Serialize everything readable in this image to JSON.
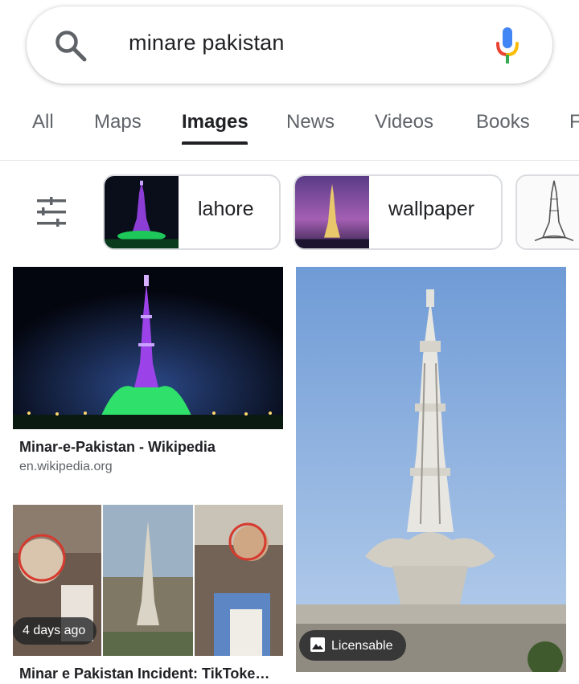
{
  "search": {
    "query": "minare pakistan"
  },
  "tabs": [
    {
      "label": "All"
    },
    {
      "label": "Maps"
    },
    {
      "label": "Images"
    },
    {
      "label": "News"
    },
    {
      "label": "Videos"
    },
    {
      "label": "Books"
    },
    {
      "label": "F"
    }
  ],
  "chips": [
    {
      "label": "lahore"
    },
    {
      "label": "wallpaper"
    },
    {
      "label": ""
    }
  ],
  "results": [
    {
      "title": "Minar-e-Pakistan - Wikipedia",
      "source": "en.wikipedia.org"
    },
    {
      "badge": "Licensable"
    },
    {
      "title": "Minar e Pakistan Incident: TikToke…",
      "badge": "4 days ago"
    }
  ],
  "colors": {
    "google_blue": "#4285f4",
    "google_red": "#ea4335",
    "google_yellow": "#fbbc05",
    "google_green": "#34a853",
    "text_primary": "#202124",
    "text_secondary": "#5f6368"
  }
}
